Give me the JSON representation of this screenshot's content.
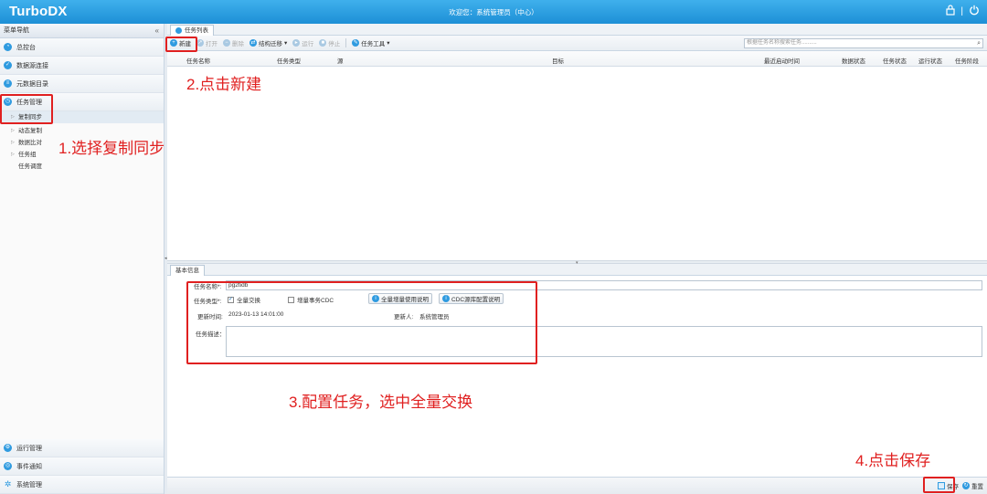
{
  "topbar": {
    "logo": "TurboDX",
    "welcome": "欢迎您：系统管理员（中心）",
    "icons": [
      "lock-icon",
      "separator",
      "power-icon"
    ]
  },
  "sidebar": {
    "header": "菜单导航",
    "collapse": "«",
    "items": [
      {
        "label": "总控台",
        "icon": "dashboard-icon"
      },
      {
        "label": "数据源连接",
        "icon": "datasource-icon"
      },
      {
        "label": "元数据目录",
        "icon": "metadata-icon"
      },
      {
        "label": "任务管理",
        "icon": "task-icon"
      }
    ],
    "selected_sub": "复制同步",
    "tree": [
      "动态复制",
      "数据比对",
      "任务组",
      "任务调度"
    ],
    "bottom_items": [
      {
        "label": "运行管理",
        "icon": "run-icon"
      },
      {
        "label": "事件通知",
        "icon": "notify-icon"
      },
      {
        "label": "系统管理",
        "icon": "gear-icon"
      }
    ]
  },
  "main": {
    "tab": "任务列表",
    "toolbar": {
      "new": "新建",
      "open": "打开",
      "delete": "删除",
      "migrate": "结构迁移",
      "run": "运行",
      "stop": "停止",
      "tools": "任务工具",
      "search_placeholder": "根据任务名称搜索任务.........."
    },
    "columns": [
      "任务名称",
      "任务类型",
      "源",
      "目标",
      "最近启动时间",
      "数据状态",
      "任务状态",
      "运行状态",
      "任务阶段"
    ]
  },
  "panel": {
    "tab": "基本信息",
    "name_label": "任务名称*:",
    "name_value": "pg2tidb",
    "type_label": "任务类型*:",
    "full_exchange": "全量交换",
    "full_exchange_checked": true,
    "cdc": "增量事务CDC",
    "cdc_checked": false,
    "help_full": "全量增量使用说明",
    "help_cdc": "CDC源库配置说明",
    "update_time_label": "更新时间:",
    "update_time_value": "2023-01-13 14:01:00",
    "updater_label": "更新人:",
    "updater_value": "系统管理员",
    "desc_label": "任务描述："
  },
  "footer": {
    "save": "保存",
    "reset": "重置"
  },
  "annotations": {
    "step1": "1.选择复制同步",
    "step2": "2.点击新建",
    "step3": "3.配置任务，选中全量交换",
    "step4": "4.点击保存",
    "color": "#e02020"
  },
  "colors": {
    "brand": "#1d8fd6",
    "accent": "#2f9be0"
  }
}
